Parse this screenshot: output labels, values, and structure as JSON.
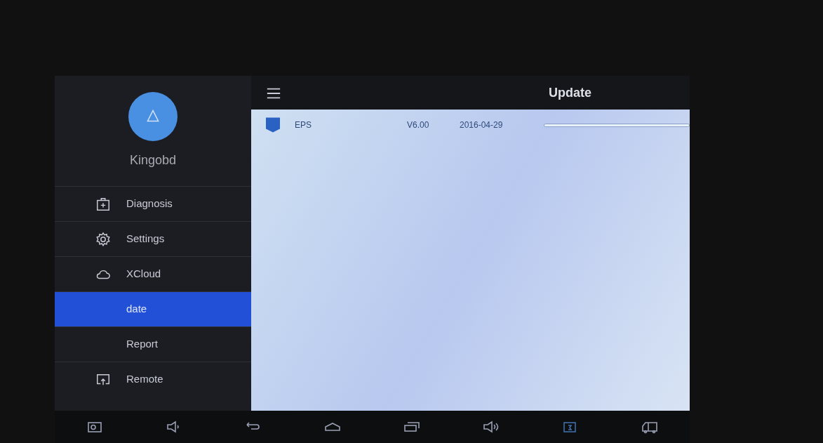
{
  "header": {
    "title": "Update"
  },
  "profile": {
    "name": "Kingobd"
  },
  "sidebar": {
    "items": [
      {
        "kind": "diagnosis",
        "label": "Diagnosis",
        "selected": false
      },
      {
        "kind": "settings",
        "label": "Settings",
        "selected": false
      },
      {
        "kind": "cloud",
        "label": "XCloud",
        "selected": false
      },
      {
        "kind": "none",
        "label": "date",
        "selected": true
      },
      {
        "kind": "none",
        "label": "Report",
        "selected": false
      },
      {
        "kind": "remote",
        "label": "Remote",
        "selected": false
      }
    ]
  },
  "updates": [
    {
      "name": "EPS",
      "version": "V6.00",
      "date": "2016-04-29",
      "level": 0
    }
  ]
}
